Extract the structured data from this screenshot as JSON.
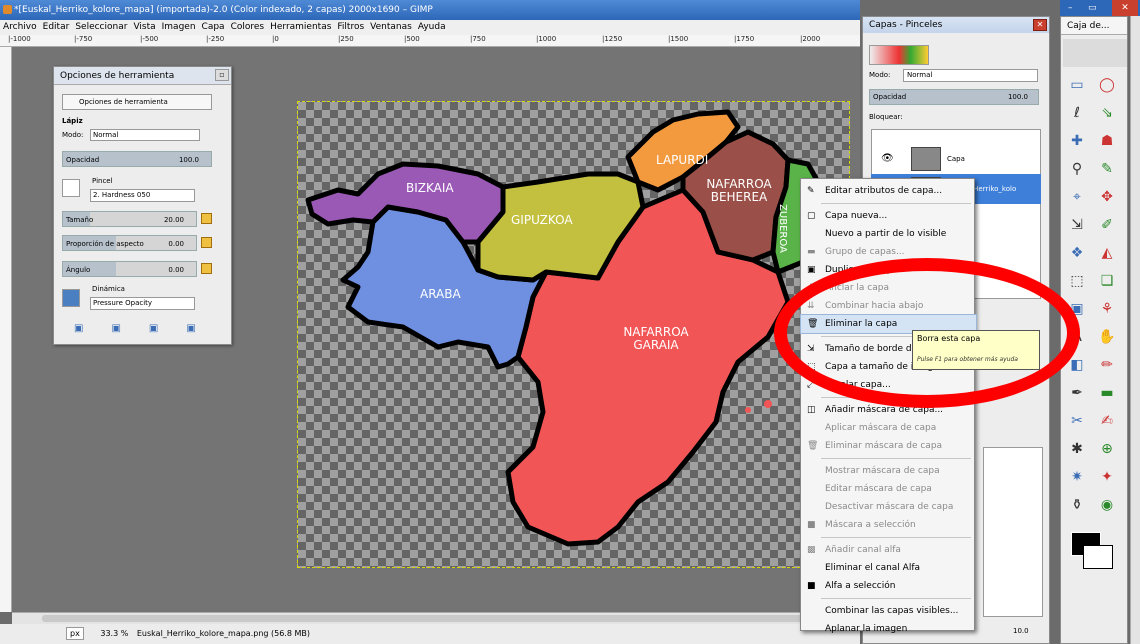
{
  "window": {
    "title": "*[Euskal_Herriko_kolore_mapa] (importada)-2.0 (Color indexado, 2 capas) 2000x1690 – GIMP"
  },
  "menubar": [
    "Archivo",
    "Editar",
    "Seleccionar",
    "Vista",
    "Imagen",
    "Capa",
    "Colores",
    "Herramientas",
    "Filtros",
    "Ventanas",
    "Ayuda"
  ],
  "ruler_ticks": [
    "|-1000",
    "|-750",
    "|-500",
    "|-250",
    "|0",
    "|250",
    "|500",
    "|750",
    "|1000",
    "|1250",
    "|1500",
    "|1750",
    "|2000"
  ],
  "map_regions": {
    "bizkaia": "BIZKAIA",
    "gipuzkoa": "GIPUZKOA",
    "araba": "ARABA",
    "lapurdi": "LAPURDI",
    "nafarroa_beherea": "NAFARROA BEHEREA",
    "zuberoa": "ZUBEROA",
    "nafarroa_garaia": "NAFARROA GARAIA"
  },
  "tool_options": {
    "title": "Opciones de herramienta",
    "tab_label": "Opciones de herramienta",
    "tool_name": "Lápiz",
    "mode_label": "Modo:",
    "mode_value": "Normal",
    "opacity_label": "Opacidad",
    "opacity_value": "100.0",
    "opacity_fraction": 1.0,
    "brush_label": "Pincel",
    "brush_value": "2. Hardness 050",
    "size_label": "Tamaño",
    "size_value": "20.00",
    "size_fraction": 0.2,
    "aspect_label": "Proporción de aspecto",
    "aspect_value": "0.00",
    "angle_label": "Ángulo",
    "angle_value": "0.00",
    "dynamics_label": "Dinámica",
    "dynamics_value": "Pressure Opacity"
  },
  "layers_panel": {
    "title": "Capas - Pinceles",
    "mode_label": "Modo:",
    "mode_value": "Normal",
    "opacity_label": "Opacidad",
    "opacity_value": "100.0",
    "lock_label": "Bloquear:",
    "layers": [
      {
        "name": "Capa",
        "selected": false
      },
      {
        "name": "Euskal_Herriko_kolo",
        "selected": true
      }
    ],
    "bottom_value": "10.0"
  },
  "toolbox": {
    "title": "Caja de...",
    "tools": [
      "▭",
      "◯",
      "ℓ",
      "⇘",
      "✚",
      "☗",
      "⚲",
      "✎",
      "⌖",
      "✥",
      "⇲",
      "✐",
      "❖",
      "◭",
      "⬚",
      "❏",
      "▣",
      "⚘",
      "A",
      "✋",
      "◧",
      "✏",
      "✒",
      "▬",
      "✂",
      "✍",
      "✱",
      "⊕",
      "✷",
      "✦",
      "⚱",
      "◉"
    ]
  },
  "context_menu": {
    "items": [
      {
        "label": "Editar atributos de capa...",
        "disabled": false,
        "icon": "✎"
      },
      {
        "sep": true
      },
      {
        "label": "Capa nueva...",
        "disabled": false,
        "icon": "▢"
      },
      {
        "label": "Nuevo a partir de lo visible",
        "disabled": false,
        "icon": ""
      },
      {
        "label": "Grupo de capas...",
        "disabled": true,
        "icon": "▬"
      },
      {
        "label": "Duplicar la capa",
        "disabled": false,
        "icon": "▣"
      },
      {
        "label": "Anclar la capa",
        "disabled": true,
        "icon": "⚓"
      },
      {
        "label": "Combinar hacia abajo",
        "disabled": true,
        "icon": "⇊"
      },
      {
        "label": "Eliminar la capa",
        "disabled": false,
        "icon": "🗑",
        "hover": true
      },
      {
        "sep": true
      },
      {
        "label": "Tamaño de borde de capa...",
        "disabled": false,
        "icon": "⇲"
      },
      {
        "label": "Capa a tamaño de imagen",
        "disabled": false,
        "icon": "⬚"
      },
      {
        "label": "Escalar capa...",
        "disabled": false,
        "icon": "⤢"
      },
      {
        "sep": true
      },
      {
        "label": "Añadir máscara de capa...",
        "disabled": false,
        "icon": "◫"
      },
      {
        "label": "Aplicar máscara de capa",
        "disabled": true,
        "icon": ""
      },
      {
        "label": "Eliminar máscara de capa",
        "disabled": true,
        "icon": "🗑"
      },
      {
        "sep": true
      },
      {
        "label": "Mostrar máscara de capa",
        "disabled": true,
        "icon": ""
      },
      {
        "label": "Editar máscara de capa",
        "disabled": true,
        "icon": ""
      },
      {
        "label": "Desactivar máscara de capa",
        "disabled": true,
        "icon": ""
      },
      {
        "label": "Máscara a selección",
        "disabled": true,
        "icon": "■"
      },
      {
        "sep": true
      },
      {
        "label": "Añadir canal alfa",
        "disabled": true,
        "icon": "▩"
      },
      {
        "label": "Eliminar el canal Alfa",
        "disabled": false,
        "icon": ""
      },
      {
        "label": "Alfa a selección",
        "disabled": false,
        "icon": "■"
      },
      {
        "sep": true
      },
      {
        "label": "Combinar las capas visibles...",
        "disabled": false,
        "icon": ""
      },
      {
        "label": "Aplanar la imagen",
        "disabled": false,
        "icon": ""
      }
    ]
  },
  "tooltip": {
    "title": "Borra esta capa",
    "hint": "Pulse F1 para obtener más ayuda"
  },
  "statusbar": {
    "unit": "px",
    "zoom": "33.3 %",
    "file": "Euskal_Herriko_kolore_mapa.png (56.8 MB)"
  },
  "colors": {
    "bizkaia": "#9b59b6",
    "gipuzkoa": "#c3bf3f",
    "araba": "#6f8fe0",
    "lapurdi": "#f39a3f",
    "nafarroa_beherea": "#9a5048",
    "zuberoa": "#5ab348",
    "nafarroa_garaia": "#f25555",
    "annotation": "#ff0000"
  }
}
